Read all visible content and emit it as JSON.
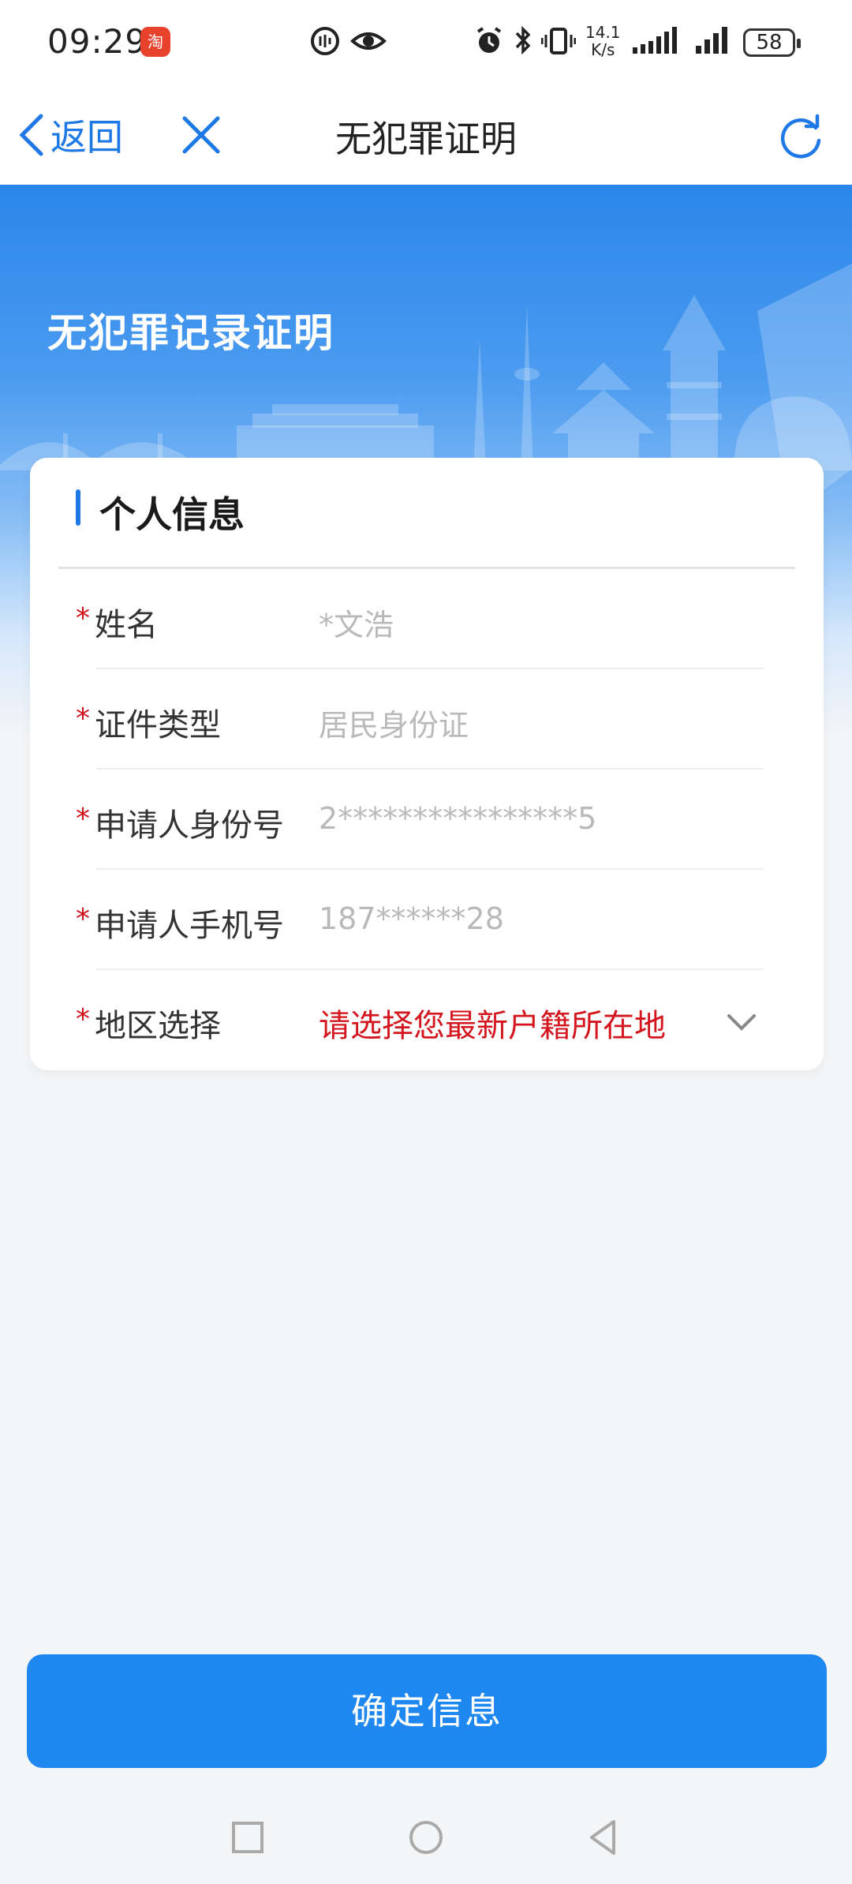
{
  "status_bar": {
    "time": "09:29",
    "app_badge": "淘",
    "net_speed_value": "14.1",
    "net_speed_unit": "K/s",
    "battery": "58"
  },
  "nav": {
    "back_label": "返回",
    "title": "无犯罪证明"
  },
  "banner": {
    "title": "无犯罪记录证明"
  },
  "card": {
    "title": "个人信息",
    "required_mark": "*",
    "fields": [
      {
        "label": "姓名",
        "value": "*文浩"
      },
      {
        "label": "证件类型",
        "value": "居民身份证"
      },
      {
        "label": "申请人身份号",
        "value": "2****************5"
      },
      {
        "label": "申请人手机号",
        "value": "187******28"
      },
      {
        "label": "地区选择",
        "value": "请选择您最新户籍所在地"
      }
    ]
  },
  "confirm_button": "确定信息",
  "colors": {
    "accent": "#1e78e6",
    "button": "#1e87f0",
    "required": "#d0111b",
    "hint_red": "#d4161e"
  }
}
